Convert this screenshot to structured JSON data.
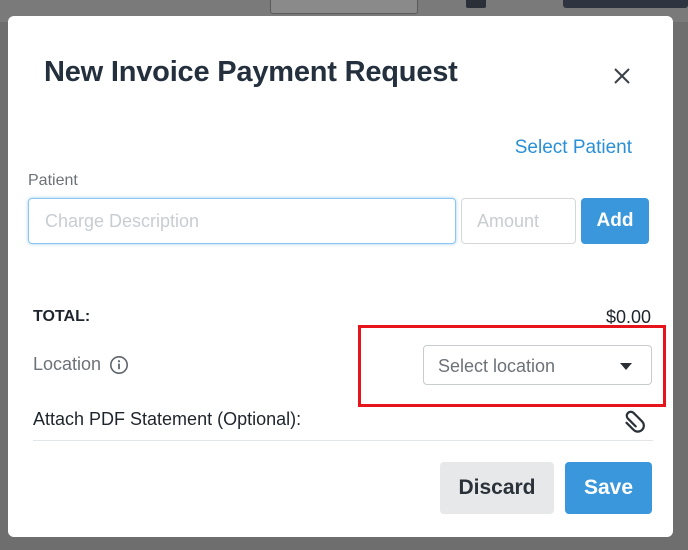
{
  "modal": {
    "title": "New Invoice Payment Request",
    "select_patient_link": "Select Patient",
    "patient_label": "Patient",
    "charge_input": {
      "value": "",
      "placeholder": "Charge Description"
    },
    "amount_input": {
      "value": "",
      "placeholder": "Amount"
    },
    "add_label": "Add",
    "total_label": "TOTAL:",
    "total_value": "$0.00",
    "location_label": "Location",
    "location_select_value": "Select location",
    "attach_label": "Attach PDF Statement (Optional):",
    "discard_label": "Discard",
    "save_label": "Save"
  },
  "icons": {
    "close": "close-icon",
    "info": "info-icon",
    "caret": "chevron-down-icon",
    "attach": "paperclip-icon"
  },
  "colors": {
    "accent": "#3a97dc",
    "link": "#2a8fd6",
    "highlight": "#e8141c",
    "title": "#24303d"
  }
}
